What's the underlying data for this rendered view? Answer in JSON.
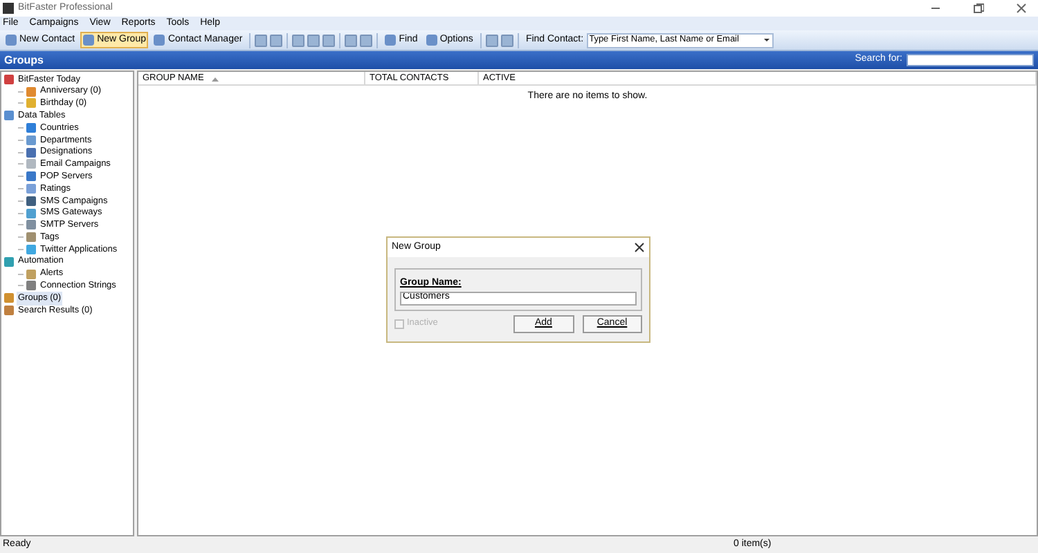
{
  "window": {
    "title": "BitFaster Professional"
  },
  "menu": [
    "File",
    "Campaigns",
    "View",
    "Reports",
    "Tools",
    "Help"
  ],
  "toolbar": [
    {
      "kind": "button",
      "label": "New Contact",
      "selected": false
    },
    {
      "kind": "button",
      "label": "New Group",
      "selected": true
    },
    {
      "kind": "button",
      "label": "Contact Manager",
      "selected": false
    },
    {
      "kind": "separator"
    },
    {
      "kind": "icon"
    },
    {
      "kind": "icon"
    },
    {
      "kind": "separator"
    },
    {
      "kind": "icon"
    },
    {
      "kind": "icon"
    },
    {
      "kind": "icon"
    },
    {
      "kind": "separator"
    },
    {
      "kind": "icon"
    },
    {
      "kind": "icon"
    },
    {
      "kind": "separator"
    },
    {
      "kind": "button",
      "label": "Find",
      "selected": false
    },
    {
      "kind": "button",
      "label": "Options",
      "selected": false
    },
    {
      "kind": "separator"
    },
    {
      "kind": "icon"
    },
    {
      "kind": "icon"
    },
    {
      "kind": "separator"
    }
  ],
  "find_contact": {
    "label": "Find Contact:",
    "placeholder": "Type First Name, Last Name or Email"
  },
  "header": {
    "title": "Groups",
    "search_label": "Search for:"
  },
  "tree": [
    {
      "label": "BitFaster Today",
      "color": "#d04040",
      "children": [
        {
          "label": "Anniversary (0)",
          "color": "#e08a30"
        },
        {
          "label": "Birthday (0)",
          "color": "#e0b030"
        }
      ]
    },
    {
      "label": "Data Tables",
      "color": "#5a8fd0",
      "children": [
        {
          "label": "Countries",
          "color": "#2f7fd8"
        },
        {
          "label": "Departments",
          "color": "#6a9ad0"
        },
        {
          "label": "Designations",
          "color": "#4a70b0"
        },
        {
          "label": "Email Campaigns",
          "color": "#b0b8c0"
        },
        {
          "label": "POP Servers",
          "color": "#3a78c8"
        },
        {
          "label": "Ratings",
          "color": "#7aa0d8"
        },
        {
          "label": "SMS Campaigns",
          "color": "#406080"
        },
        {
          "label": "SMS Gateways",
          "color": "#50a0d0"
        },
        {
          "label": "SMTP Servers",
          "color": "#8090a0"
        },
        {
          "label": "Tags",
          "color": "#a09070"
        },
        {
          "label": "Twitter Applications",
          "color": "#40a8e0"
        }
      ]
    },
    {
      "label": "Automation",
      "color": "#30a0b0",
      "children": [
        {
          "label": "Alerts",
          "color": "#c0a060"
        },
        {
          "label": "Connection Strings",
          "color": "#808080"
        }
      ]
    },
    {
      "label": "Groups (0)",
      "color": "#d09030",
      "selected": true
    },
    {
      "label": "Search Results (0)",
      "color": "#c08040",
      "selected": false
    }
  ],
  "table": {
    "columns": [
      {
        "label": "GROUP NAME",
        "sorted": true
      },
      {
        "label": "TOTAL CONTACTS",
        "sorted": false
      },
      {
        "label": "ACTIVE",
        "sorted": false
      }
    ],
    "empty_text": "There are no items to show."
  },
  "dialog": {
    "title": "New Group",
    "field_label": "Group Name:",
    "value": "Customers",
    "checkbox": {
      "label": "Inactive",
      "checked": false,
      "disabled": true
    },
    "buttons": [
      "Add",
      "Cancel"
    ]
  },
  "status_bar": {
    "left": "Ready",
    "right": "0 item(s)"
  }
}
